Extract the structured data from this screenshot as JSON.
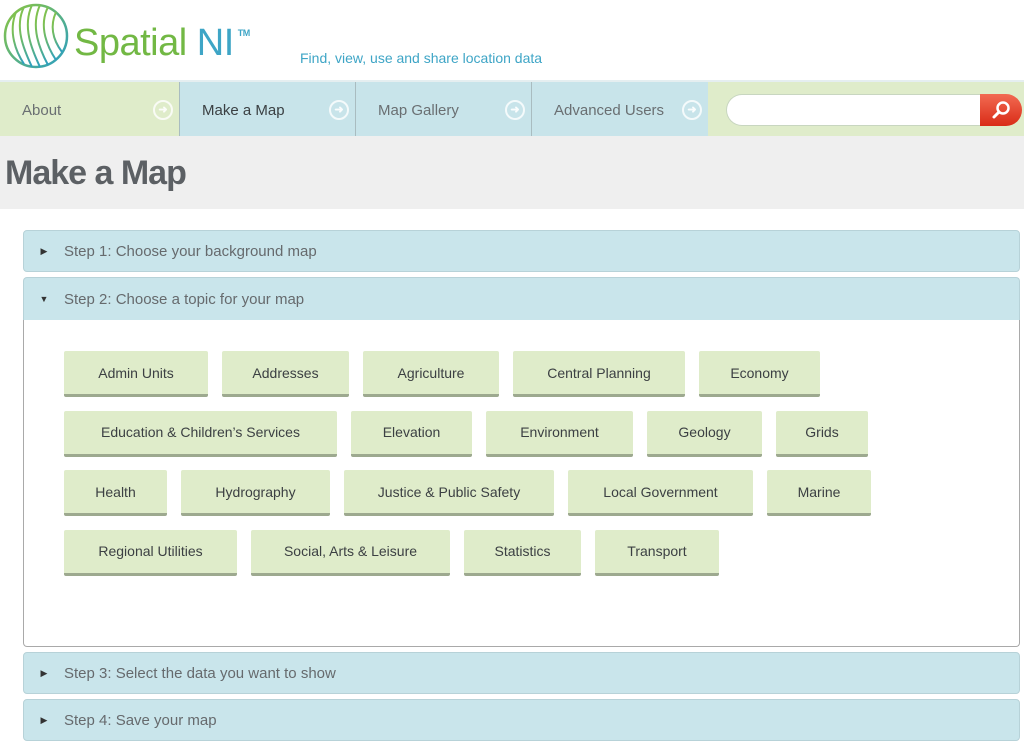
{
  "header": {
    "brand_name": "Spatial ",
    "brand_ni": "NI",
    "brand_tm": "TM",
    "tagline": "Find, view, use and share location data",
    "logo_icon": "globe-stripes-icon"
  },
  "nav": {
    "items": [
      {
        "label": "About",
        "icon": "arrow-circle-right-icon"
      },
      {
        "label": "Make a Map",
        "icon": "arrow-circle-right-icon",
        "active": true
      },
      {
        "label": "Map Gallery",
        "icon": "arrow-circle-right-icon"
      },
      {
        "label": "Advanced Users",
        "icon": "arrow-circle-right-icon"
      }
    ],
    "search": {
      "value": "",
      "placeholder": "",
      "button_icon": "search-icon"
    }
  },
  "page_title": "Make a Map",
  "steps": [
    {
      "label": "Step 1: Choose your background map",
      "expanded": false
    },
    {
      "label": "Step 2: Choose a topic for your map",
      "expanded": true
    },
    {
      "label": "Step 3: Select the data you want to show",
      "expanded": false
    },
    {
      "label": "Step 4: Save your map",
      "expanded": false
    }
  ],
  "topics": [
    [
      "Admin Units",
      "Addresses",
      "Agriculture",
      "Central Planning",
      "Economy"
    ],
    [
      "Education & Children’s Services",
      "Elevation",
      "Environment",
      "Geology",
      "Grids"
    ],
    [
      "Health",
      "Hydrography",
      "Justice & Public Safety",
      "Local Government",
      "Marine"
    ],
    [
      "Regional Utilities",
      "Social, Arts & Leisure",
      "Statistics",
      "Transport"
    ]
  ],
  "colors": {
    "brand_green": "#72b844",
    "brand_blue": "#3ea5c6",
    "nav_green": "#dfecca",
    "nav_blue": "#c8e4ea",
    "search_red": "#e0412b"
  }
}
